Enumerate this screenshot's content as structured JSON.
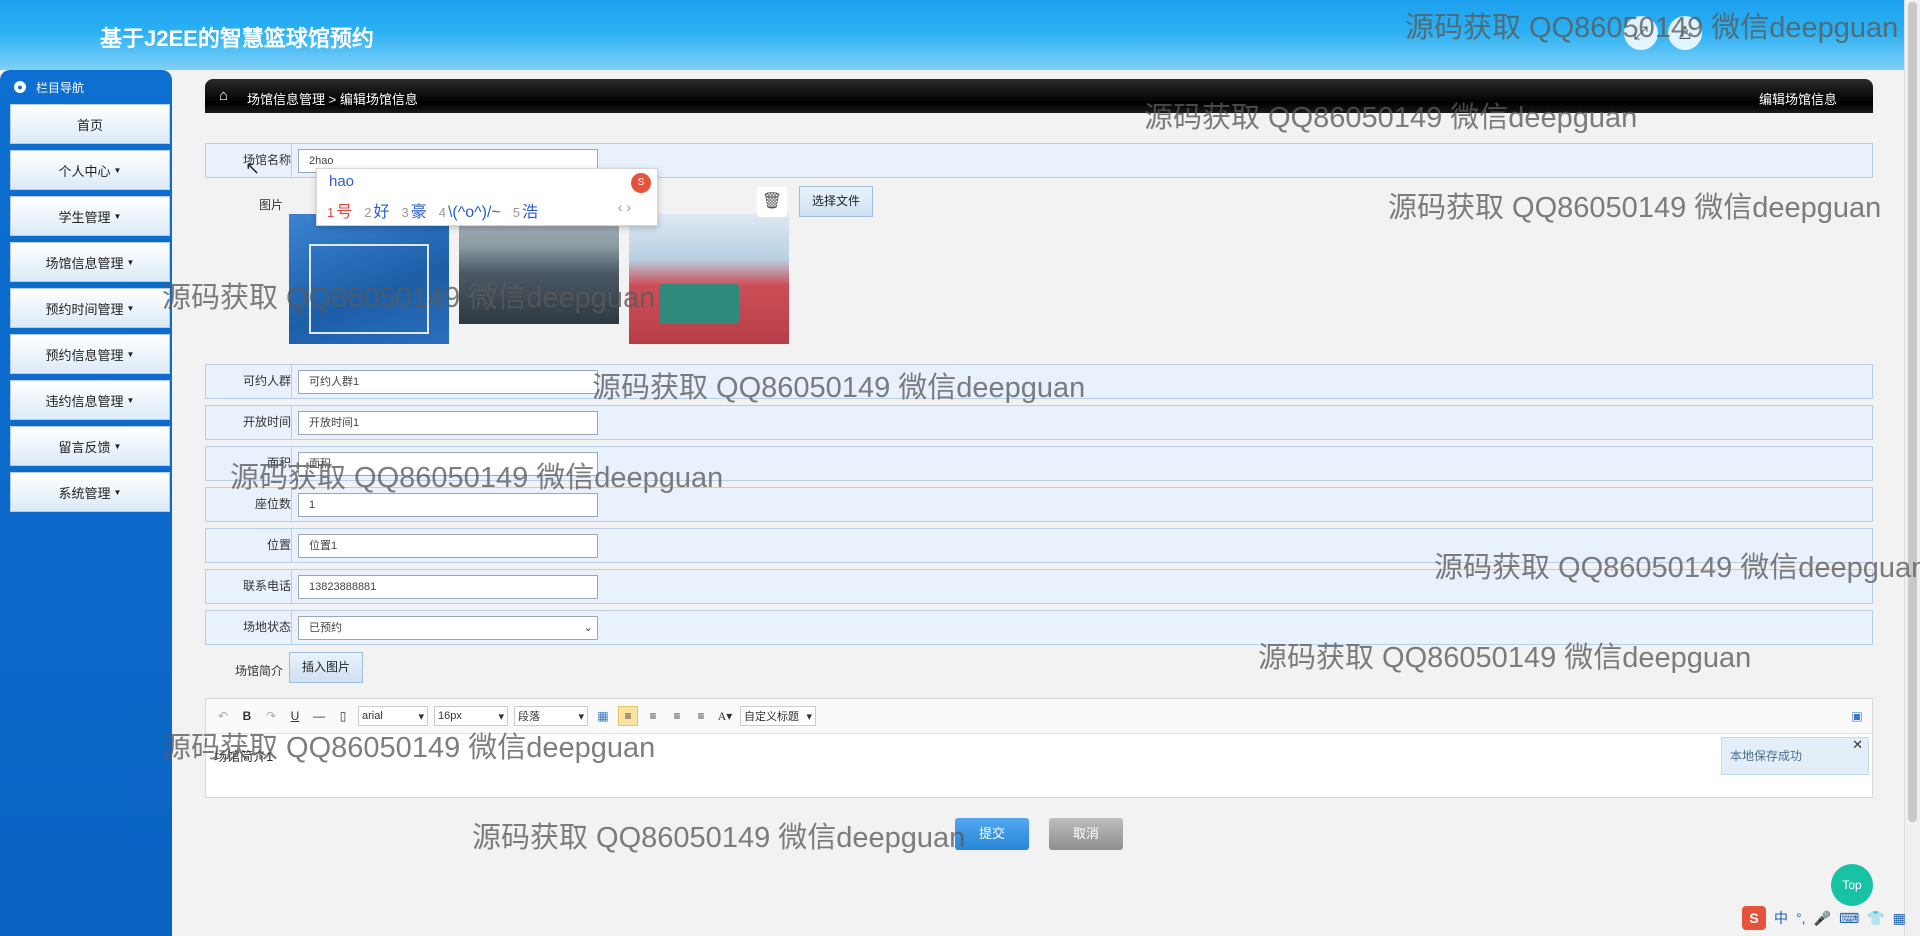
{
  "header": {
    "title": "基于J2EE的智慧篮球馆预约",
    "expand_icon": "expand-icon",
    "user_icon": "user-icon"
  },
  "sidebar": {
    "title": "栏目导航",
    "items": [
      {
        "label": "首页",
        "has_caret": false
      },
      {
        "label": "个人中心",
        "has_caret": true
      },
      {
        "label": "学生管理",
        "has_caret": true
      },
      {
        "label": "场馆信息管理",
        "has_caret": true
      },
      {
        "label": "预约时间管理",
        "has_caret": true
      },
      {
        "label": "预约信息管理",
        "has_caret": true
      },
      {
        "label": "违约信息管理",
        "has_caret": true
      },
      {
        "label": "留言反馈",
        "has_caret": true
      },
      {
        "label": "系统管理",
        "has_caret": true
      }
    ]
  },
  "breadcrumb": {
    "path": "场馆信息管理 > 编辑场馆信息",
    "page_title": "编辑场馆信息"
  },
  "form": {
    "name": {
      "label": "场馆名称",
      "value": "2hao"
    },
    "image": {
      "label": "图片",
      "choose_button": "选择文件"
    },
    "crowd": {
      "label": "可约人群",
      "value": "可约人群1"
    },
    "open_time": {
      "label": "开放时间",
      "value": "开放时间1"
    },
    "area": {
      "label": "面积",
      "value": "面积"
    },
    "seats": {
      "label": "座位数",
      "value": "1"
    },
    "location": {
      "label": "位置",
      "value": "位置1"
    },
    "phone": {
      "label": "联系电话",
      "value": "13823888881"
    },
    "status": {
      "label": "场地状态",
      "value": "已预约"
    },
    "intro": {
      "label": "场馆简介",
      "insert_button": "插入图片",
      "content": "场馆简介1"
    }
  },
  "ime_popup": {
    "composition": "hao",
    "candidates": [
      {
        "num": "1",
        "text": "号"
      },
      {
        "num": "2",
        "text": "好"
      },
      {
        "num": "3",
        "text": "豪"
      },
      {
        "num": "4",
        "text": "\\(^o^)/~"
      },
      {
        "num": "5",
        "text": "浩"
      }
    ]
  },
  "editor": {
    "font_family": "arial",
    "font_size": "16px",
    "paragraph": "段落",
    "custom_title": "自定义标题",
    "toast": "本地保存成功"
  },
  "actions": {
    "save": "提交",
    "cancel": "取消",
    "top": "Top"
  },
  "ime_bar": {
    "lang": "中"
  },
  "watermark": "源码获取 QQ86050149 微信deepguan"
}
